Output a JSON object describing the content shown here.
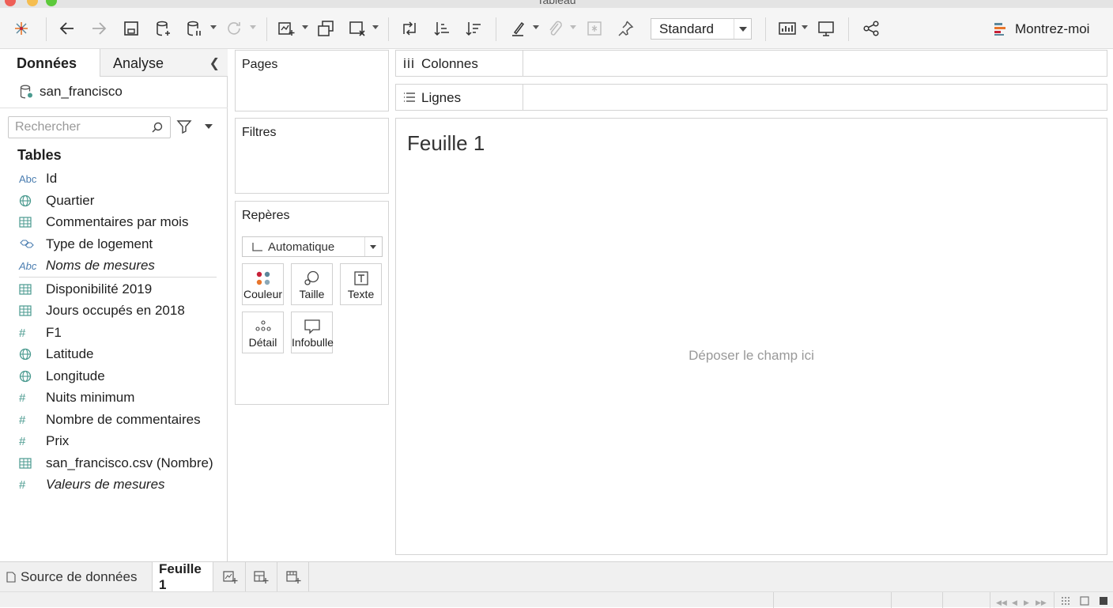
{
  "window": {
    "title": "Tableau"
  },
  "toolbar": {
    "format_select": "Standard",
    "show_me_label": "Montrez-moi"
  },
  "data_pane": {
    "tabs": [
      {
        "label": "Données",
        "active": true
      },
      {
        "label": "Analyse",
        "active": false
      }
    ],
    "data_source": "san_francisco",
    "search_placeholder": "Rechercher",
    "tables_heading": "Tables",
    "dimensions": [
      {
        "type_icon": "Abc",
        "label": "Id"
      },
      {
        "type_icon": "globe-icon",
        "label": "Quartier"
      },
      {
        "type_icon": "table-icon",
        "label": "Commentaires par mois"
      },
      {
        "type_icon": "group-icon",
        "label": "Type de logement"
      },
      {
        "type_icon": "Abc",
        "label": "Noms de mesures"
      }
    ],
    "measures": [
      {
        "type_icon": "table-icon",
        "label": "Disponibilité 2019"
      },
      {
        "type_icon": "table-icon",
        "label": "Jours occupés en 2018"
      },
      {
        "type_icon": "#",
        "label": "F1"
      },
      {
        "type_icon": "globe-icon",
        "label": "Latitude"
      },
      {
        "type_icon": "globe-icon",
        "label": "Longitude"
      },
      {
        "type_icon": "#",
        "label": "Nuits minimum"
      },
      {
        "type_icon": "#",
        "label": "Nombre de commentaires"
      },
      {
        "type_icon": "#",
        "label": "Prix"
      },
      {
        "type_icon": "table-icon",
        "label": "san_francisco.csv (Nombre)"
      },
      {
        "type_icon": "#",
        "label": "Valeurs de mesures"
      }
    ]
  },
  "cards": {
    "pages_title": "Pages",
    "filters_title": "Filtres",
    "marks_title": "Repères",
    "marks_type": "Automatique",
    "marks_buttons": [
      "Couleur",
      "Taille",
      "Texte",
      "Détail",
      "Infobulle"
    ]
  },
  "shelves": {
    "columns_label": "Colonnes",
    "rows_label": "Lignes"
  },
  "view": {
    "sheet_title": "Feuille 1",
    "drop_hint": "Déposer le champ ici"
  },
  "bottom_tabs": {
    "data_source_label": "Source de données",
    "active_sheet_label": "Feuille 1"
  },
  "colors": {
    "field_icon": "#4a9a8f",
    "toolbar_bg": "#f5f5f5",
    "border": "#d4d4d4"
  }
}
